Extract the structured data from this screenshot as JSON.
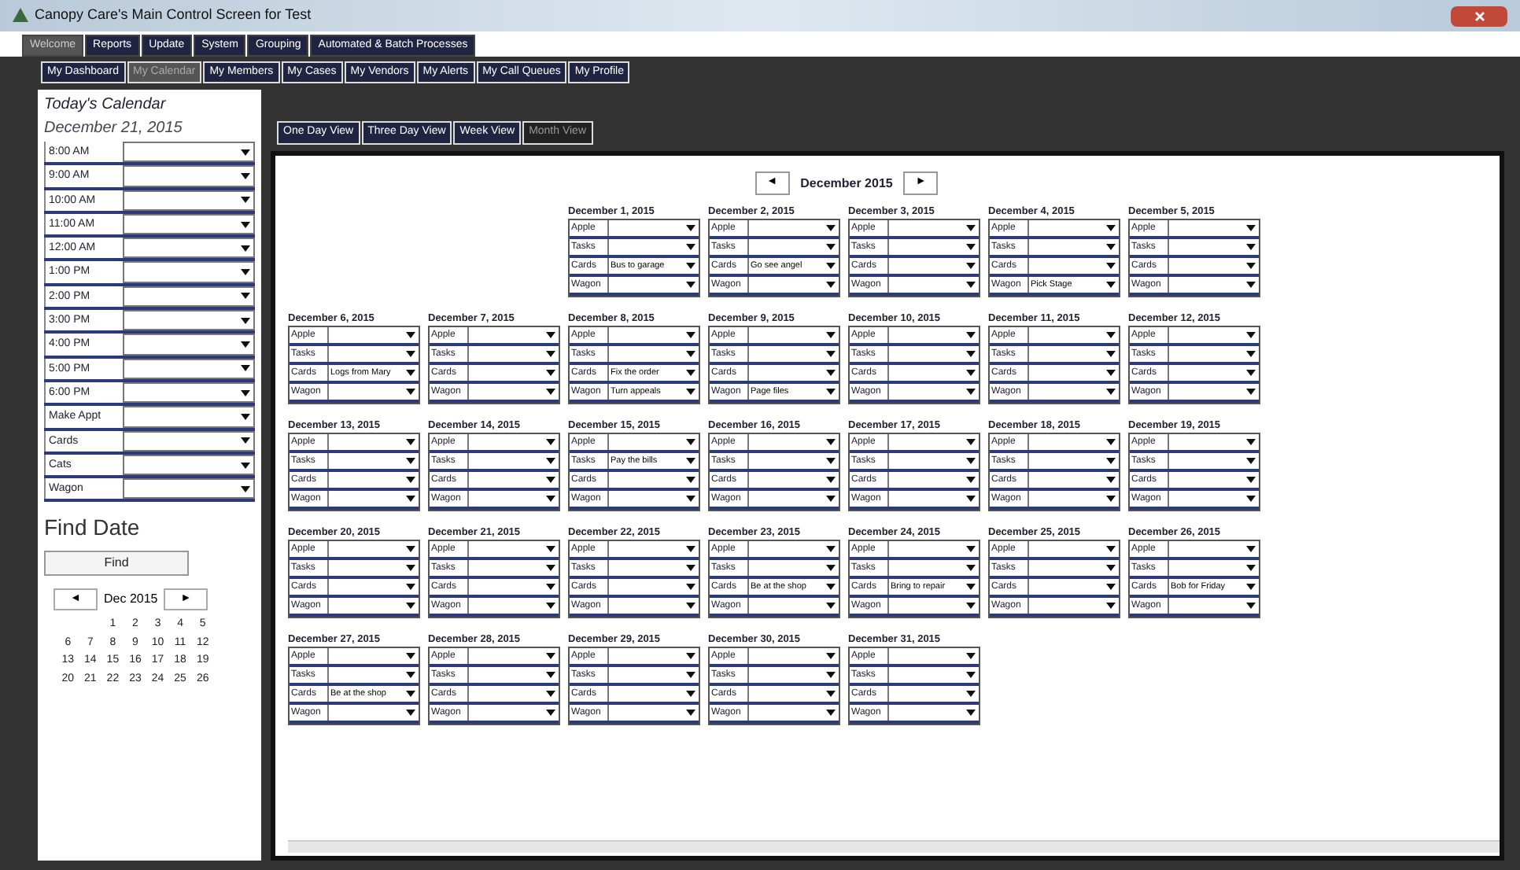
{
  "window": {
    "title": "Canopy Care's Main Control Screen for Test"
  },
  "main_tabs": [
    {
      "label": "Welcome",
      "selected": true
    },
    {
      "label": "Reports",
      "selected": false
    },
    {
      "label": "Update",
      "selected": false
    },
    {
      "label": "System",
      "selected": false
    },
    {
      "label": "Grouping",
      "selected": false
    },
    {
      "label": "Automated & Batch Processes",
      "selected": false
    }
  ],
  "sub_tabs": [
    {
      "label": "My Dashboard",
      "selected": false
    },
    {
      "label": "My Calendar",
      "selected": true
    },
    {
      "label": "My Members",
      "selected": false
    },
    {
      "label": "My Cases",
      "selected": false
    },
    {
      "label": "My Vendors",
      "selected": false
    },
    {
      "label": "My Alerts",
      "selected": false
    },
    {
      "label": "My Call Queues",
      "selected": false
    },
    {
      "label": "My Profile",
      "selected": false
    }
  ],
  "today": {
    "heading": "Today's Calendar",
    "date": "December 21, 2015",
    "slots": [
      {
        "label": "8:00 AM"
      },
      {
        "label": "9:00 AM"
      },
      {
        "label": "10:00 AM"
      },
      {
        "label": "11:00 AM"
      },
      {
        "label": "12:00 AM"
      },
      {
        "label": "1:00 PM"
      },
      {
        "label": "2:00 PM"
      },
      {
        "label": "3:00 PM"
      },
      {
        "label": "4:00 PM"
      },
      {
        "label": "5:00 PM"
      },
      {
        "label": "6:00 PM"
      },
      {
        "label": "Make Appt"
      },
      {
        "label": "Cards"
      },
      {
        "label": "Cats"
      },
      {
        "label": "Wagon"
      }
    ]
  },
  "find_date": {
    "heading": "Find Date",
    "button": "Find",
    "calendar": {
      "prev": "◄",
      "month": "Dec 2015",
      "next": "►",
      "weeks": [
        [
          {
            "kind": "blank"
          },
          {
            "kind": "blank"
          },
          "1",
          "2",
          "3",
          "4",
          "5"
        ],
        [
          "6",
          "7",
          "8",
          "9",
          "10",
          "11",
          "12"
        ],
        [
          "13",
          "14",
          "15",
          "16",
          "17",
          "18",
          "19"
        ],
        [
          "20",
          "21",
          "22",
          "23",
          "24",
          "25",
          "26"
        ]
      ]
    }
  },
  "view_tabs": [
    {
      "label": "One Day View",
      "selected": false
    },
    {
      "label": "Three Day View",
      "selected": false
    },
    {
      "label": "Week View",
      "selected": false
    },
    {
      "label": "Month View",
      "selected": true
    }
  ],
  "month_nav": {
    "prev": "◄",
    "label": "December 2015",
    "next": "►"
  },
  "weeks": [
    [
      {
        "kind": "blank"
      },
      {
        "kind": "blank"
      },
      {
        "title": "December 1, 2015",
        "entries": [
          {
            "label": "Apple"
          },
          {
            "label": "Tasks"
          },
          {
            "label": "Cards",
            "value": "Bus to garage"
          },
          {
            "label": "Wagon"
          }
        ]
      },
      {
        "title": "December 2, 2015",
        "entries": [
          {
            "label": "Apple"
          },
          {
            "label": "Tasks"
          },
          {
            "label": "Cards",
            "value": "Go see angel"
          },
          {
            "label": "Wagon"
          }
        ]
      },
      {
        "title": "December 3, 2015",
        "entries": [
          {
            "label": "Apple"
          },
          {
            "label": "Tasks"
          },
          {
            "label": "Cards"
          },
          {
            "label": "Wagon"
          }
        ]
      },
      {
        "title": "December 4, 2015",
        "entries": [
          {
            "label": "Apple"
          },
          {
            "label": "Tasks"
          },
          {
            "label": "Cards"
          },
          {
            "label": "Wagon",
            "value": "Pick Stage"
          }
        ]
      },
      {
        "title": "December 5, 2015",
        "entries": [
          {
            "label": "Apple"
          },
          {
            "label": "Tasks"
          },
          {
            "label": "Cards"
          },
          {
            "label": "Wagon"
          }
        ]
      }
    ],
    [
      {
        "title": "December 6, 2015",
        "entries": [
          {
            "label": "Apple"
          },
          {
            "label": "Tasks"
          },
          {
            "label": "Cards",
            "value": "Logs from Mary"
          },
          {
            "label": "Wagon"
          }
        ]
      },
      {
        "title": "December 7, 2015",
        "entries": [
          {
            "label": "Apple"
          },
          {
            "label": "Tasks"
          },
          {
            "label": "Cards"
          },
          {
            "label": "Wagon"
          }
        ]
      },
      {
        "title": "December 8, 2015",
        "entries": [
          {
            "label": "Apple"
          },
          {
            "label": "Tasks"
          },
          {
            "label": "Cards",
            "value": "Fix the order"
          },
          {
            "label": "Wagon",
            "value": "Turn appeals"
          }
        ]
      },
      {
        "title": "December 9, 2015",
        "entries": [
          {
            "label": "Apple"
          },
          {
            "label": "Tasks"
          },
          {
            "label": "Cards"
          },
          {
            "label": "Wagon",
            "value": "Page files"
          }
        ]
      },
      {
        "title": "December 10, 2015",
        "entries": [
          {
            "label": "Apple"
          },
          {
            "label": "Tasks"
          },
          {
            "label": "Cards"
          },
          {
            "label": "Wagon"
          }
        ]
      },
      {
        "title": "December 11, 2015",
        "entries": [
          {
            "label": "Apple"
          },
          {
            "label": "Tasks"
          },
          {
            "label": "Cards"
          },
          {
            "label": "Wagon"
          }
        ]
      },
      {
        "title": "December 12, 2015",
        "entries": [
          {
            "label": "Apple"
          },
          {
            "label": "Tasks"
          },
          {
            "label": "Cards"
          },
          {
            "label": "Wagon"
          }
        ]
      }
    ],
    [
      {
        "title": "December 13, 2015",
        "entries": [
          {
            "label": "Apple"
          },
          {
            "label": "Tasks"
          },
          {
            "label": "Cards"
          },
          {
            "label": "Wagon"
          }
        ]
      },
      {
        "title": "December 14, 2015",
        "entries": [
          {
            "label": "Apple"
          },
          {
            "label": "Tasks"
          },
          {
            "label": "Cards"
          },
          {
            "label": "Wagon"
          }
        ]
      },
      {
        "title": "December 15, 2015",
        "entries": [
          {
            "label": "Apple"
          },
          {
            "label": "Tasks",
            "value": "Pay the bills"
          },
          {
            "label": "Cards"
          },
          {
            "label": "Wagon"
          }
        ]
      },
      {
        "title": "December 16, 2015",
        "entries": [
          {
            "label": "Apple"
          },
          {
            "label": "Tasks"
          },
          {
            "label": "Cards"
          },
          {
            "label": "Wagon"
          }
        ]
      },
      {
        "title": "December 17, 2015",
        "entries": [
          {
            "label": "Apple"
          },
          {
            "label": "Tasks"
          },
          {
            "label": "Cards"
          },
          {
            "label": "Wagon"
          }
        ]
      },
      {
        "title": "December 18, 2015",
        "entries": [
          {
            "label": "Apple"
          },
          {
            "label": "Tasks"
          },
          {
            "label": "Cards"
          },
          {
            "label": "Wagon"
          }
        ]
      },
      {
        "title": "December 19, 2015",
        "entries": [
          {
            "label": "Apple"
          },
          {
            "label": "Tasks"
          },
          {
            "label": "Cards"
          },
          {
            "label": "Wagon"
          }
        ]
      }
    ],
    [
      {
        "title": "December 20, 2015",
        "entries": [
          {
            "label": "Apple"
          },
          {
            "label": "Tasks"
          },
          {
            "label": "Cards"
          },
          {
            "label": "Wagon"
          }
        ]
      },
      {
        "title": "December 21, 2015",
        "entries": [
          {
            "label": "Apple"
          },
          {
            "label": "Tasks"
          },
          {
            "label": "Cards"
          },
          {
            "label": "Wagon"
          }
        ]
      },
      {
        "title": "December 22, 2015",
        "entries": [
          {
            "label": "Apple"
          },
          {
            "label": "Tasks"
          },
          {
            "label": "Cards"
          },
          {
            "label": "Wagon"
          }
        ]
      },
      {
        "title": "December 23, 2015",
        "entries": [
          {
            "label": "Apple"
          },
          {
            "label": "Tasks"
          },
          {
            "label": "Cards",
            "value": "Be at the shop"
          },
          {
            "label": "Wagon"
          }
        ]
      },
      {
        "title": "December 24, 2015",
        "entries": [
          {
            "label": "Apple"
          },
          {
            "label": "Tasks"
          },
          {
            "label": "Cards",
            "value": "Bring to repair"
          },
          {
            "label": "Wagon"
          }
        ]
      },
      {
        "title": "December 25, 2015",
        "entries": [
          {
            "label": "Apple"
          },
          {
            "label": "Tasks"
          },
          {
            "label": "Cards"
          },
          {
            "label": "Wagon"
          }
        ]
      },
      {
        "title": "December 26, 2015",
        "entries": [
          {
            "label": "Apple"
          },
          {
            "label": "Tasks"
          },
          {
            "label": "Cards",
            "value": "Bob for Friday"
          },
          {
            "label": "Wagon"
          }
        ]
      }
    ],
    [
      {
        "title": "December 27, 2015",
        "entries": [
          {
            "label": "Apple"
          },
          {
            "label": "Tasks"
          },
          {
            "label": "Cards",
            "value": "Be at the shop"
          },
          {
            "label": "Wagon"
          }
        ]
      },
      {
        "title": "December 28, 2015",
        "entries": [
          {
            "label": "Apple"
          },
          {
            "label": "Tasks"
          },
          {
            "label": "Cards"
          },
          {
            "label": "Wagon"
          }
        ]
      },
      {
        "title": "December 29, 2015",
        "entries": [
          {
            "label": "Apple"
          },
          {
            "label": "Tasks"
          },
          {
            "label": "Cards"
          },
          {
            "label": "Wagon"
          }
        ]
      },
      {
        "title": "December 30, 2015",
        "entries": [
          {
            "label": "Apple"
          },
          {
            "label": "Tasks"
          },
          {
            "label": "Cards"
          },
          {
            "label": "Wagon"
          }
        ]
      },
      {
        "title": "December 31, 2015",
        "entries": [
          {
            "label": "Apple"
          },
          {
            "label": "Tasks"
          },
          {
            "label": "Cards"
          },
          {
            "label": "Wagon"
          }
        ]
      }
    ]
  ]
}
